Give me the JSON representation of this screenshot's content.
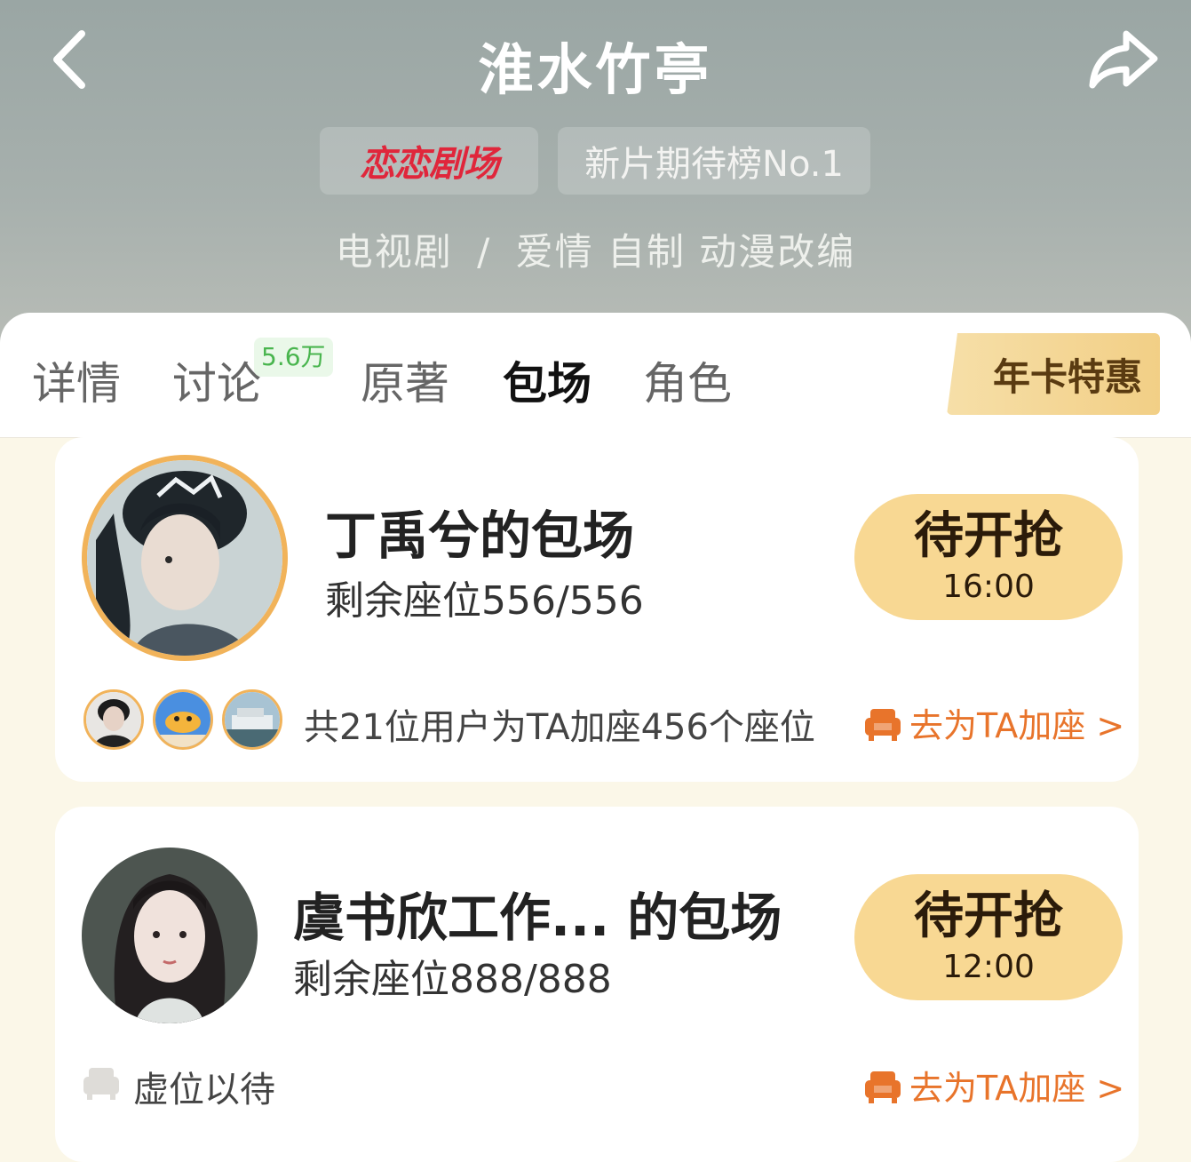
{
  "header": {
    "title": "淮水竹亭",
    "brand_tag": "恋恋剧场",
    "rank_tag": "新片期待榜No.1",
    "genre_type": "电视剧",
    "genre_sep": "/",
    "genre_tags": "爱情 自制 动漫改编"
  },
  "tabs": {
    "items": [
      "详情",
      "讨论",
      "原著",
      "包场",
      "角色"
    ],
    "discussion_badge": "5.6万",
    "active": "包场",
    "year_card_label": "年卡特惠"
  },
  "sessions": [
    {
      "title": "丁禹兮的包场",
      "seats": "剩余座位556/556",
      "status": "待开抢",
      "time": "16:00",
      "supporters_text": "共21位用户为TA加座456个座位",
      "add_seat_label": "去为TA加座 >"
    },
    {
      "title": "虞书欣工作...   的包场",
      "seats": "剩余座位888/888",
      "status": "待开抢",
      "time": "12:00",
      "supporters_text": "虚位以待",
      "add_seat_label": "去为TA加座 >"
    }
  ],
  "colors": {
    "accent_orange": "#e8742b",
    "button_gold": "#f8d893",
    "avatar_ring": "#f1b35a",
    "brand_red": "#e0263b"
  },
  "icons": {
    "back": "chevron-left-icon",
    "share": "share-arrow-icon",
    "seat": "sofa-seat-icon"
  }
}
